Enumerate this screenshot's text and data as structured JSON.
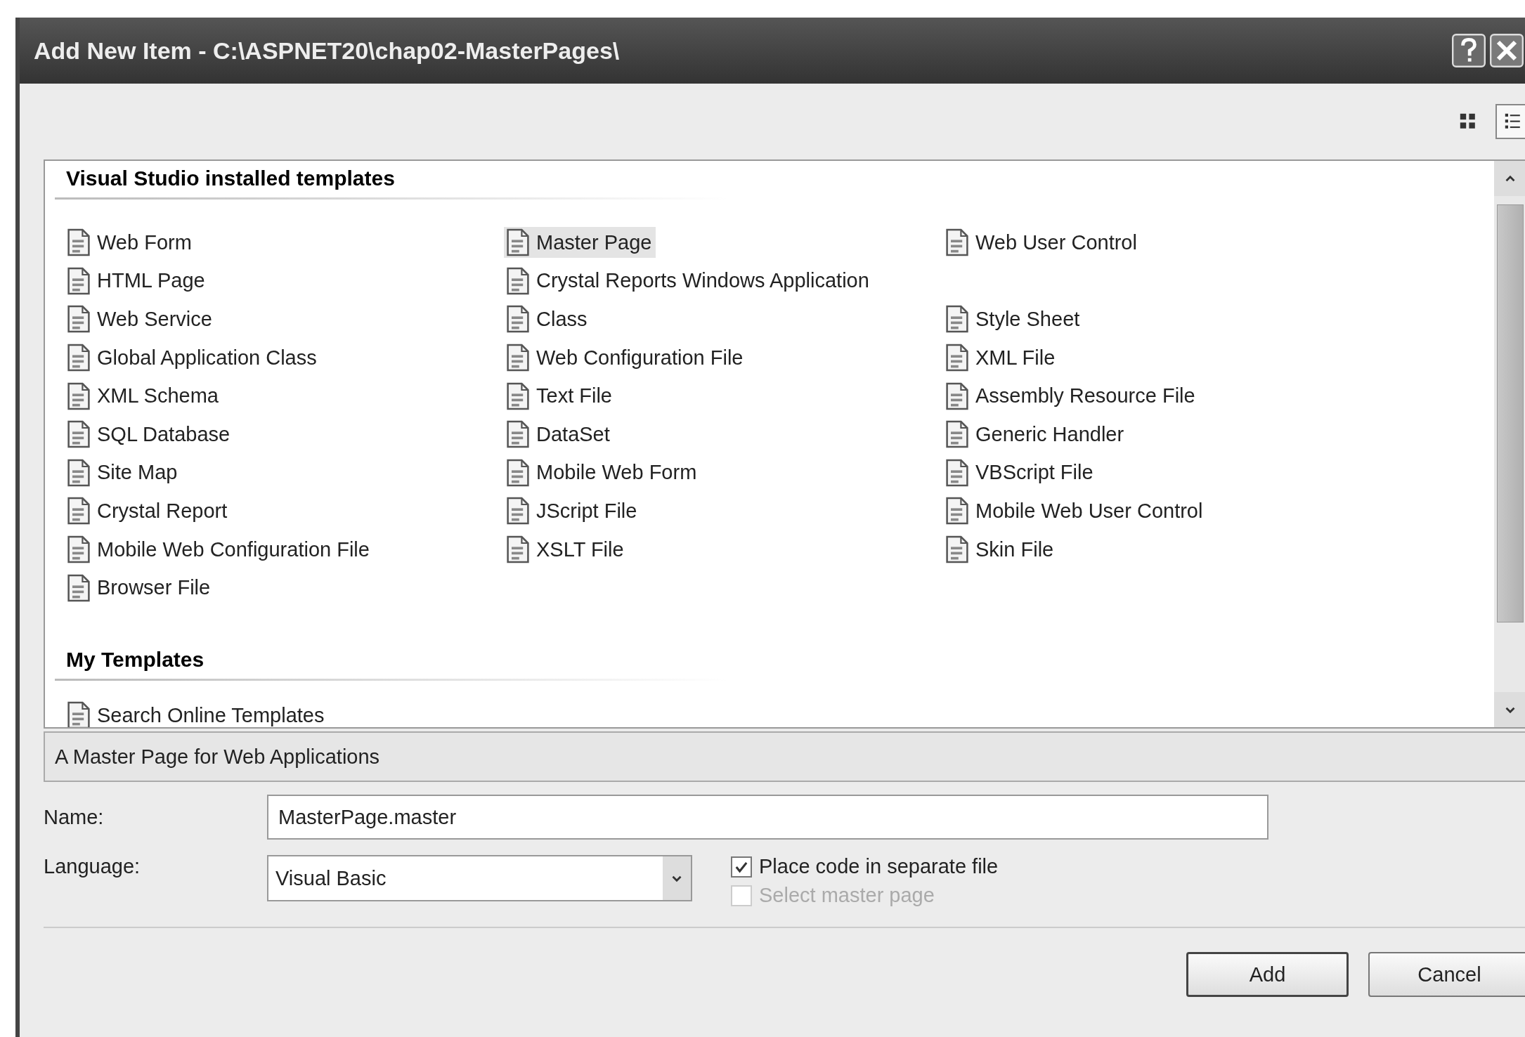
{
  "window": {
    "title": "Add New Item - C:\\ASPNET20\\chap02-MasterPages\\"
  },
  "view_buttons": [
    {
      "kind": "large-icons",
      "selected": false
    },
    {
      "kind": "small-icons",
      "selected": true
    }
  ],
  "groups": [
    {
      "title": "Visual Studio installed templates",
      "rows": [
        [
          {
            "label": "Web Form",
            "selected": false
          },
          {
            "label": "Master Page",
            "selected": true
          },
          {
            "label": "Web User Control",
            "selected": false
          }
        ],
        [
          {
            "label": "HTML Page",
            "selected": false
          },
          {
            "label": "Crystal Reports Windows Application",
            "selected": false
          }
        ],
        [
          {
            "label": "Web Service",
            "selected": false
          },
          {
            "label": "Class",
            "selected": false
          },
          {
            "label": "Style Sheet",
            "selected": false
          }
        ],
        [
          {
            "label": "Global Application Class",
            "selected": false
          },
          {
            "label": "Web Configuration File",
            "selected": false
          },
          {
            "label": "XML File",
            "selected": false
          }
        ],
        [
          {
            "label": "XML Schema",
            "selected": false
          },
          {
            "label": "Text File",
            "selected": false
          },
          {
            "label": "Assembly Resource File",
            "selected": false
          }
        ],
        [
          {
            "label": "SQL Database",
            "selected": false
          },
          {
            "label": "DataSet",
            "selected": false
          },
          {
            "label": "Generic Handler",
            "selected": false
          }
        ],
        [
          {
            "label": "Site Map",
            "selected": false
          },
          {
            "label": "Mobile Web Form",
            "selected": false
          },
          {
            "label": "VBScript File",
            "selected": false
          }
        ],
        [
          {
            "label": "Crystal Report",
            "selected": false
          },
          {
            "label": "JScript File",
            "selected": false
          },
          {
            "label": "Mobile Web User Control",
            "selected": false
          }
        ],
        [
          {
            "label": "Mobile Web Configuration File",
            "selected": false
          },
          {
            "label": "XSLT File",
            "selected": false
          },
          {
            "label": "Skin File",
            "selected": false
          }
        ],
        [
          {
            "label": "Browser File",
            "selected": false
          }
        ]
      ]
    },
    {
      "title": "My Templates",
      "rows": [
        [
          {
            "label": "Search Online Templates",
            "selected": false
          }
        ]
      ]
    }
  ],
  "description": "A Master Page for Web Applications",
  "name_field": {
    "label": "Name:",
    "value": "MasterPage.master"
  },
  "language_field": {
    "label": "Language:",
    "value": "Visual Basic"
  },
  "options": [
    {
      "label": "Place code in separate file",
      "checked": true,
      "disabled": false
    },
    {
      "label": "Select master page",
      "checked": false,
      "disabled": true
    }
  ],
  "buttons": [
    {
      "label": "Add",
      "kind": "default"
    },
    {
      "label": "Cancel",
      "kind": "normal"
    }
  ]
}
